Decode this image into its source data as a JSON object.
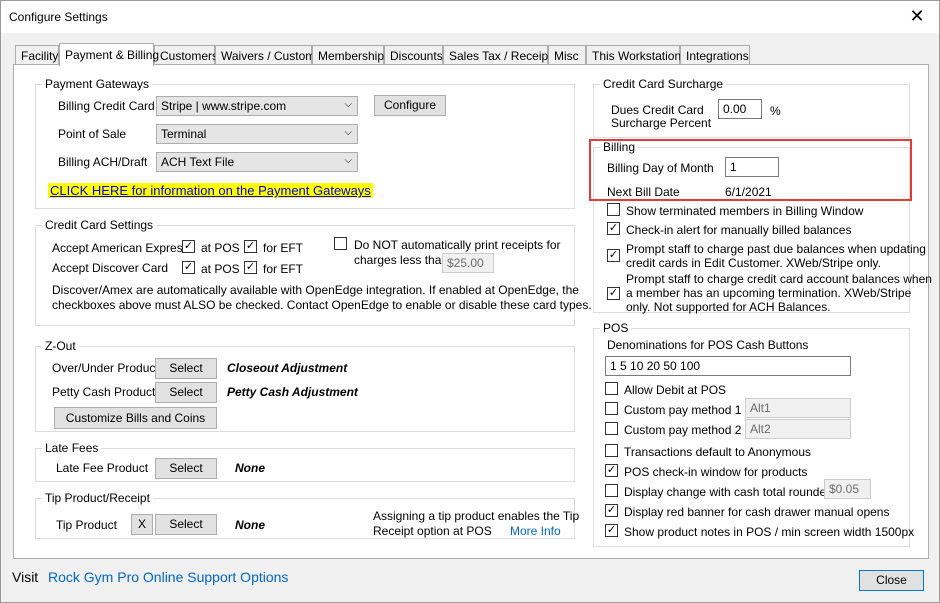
{
  "window": {
    "title": "Configure Settings",
    "close_glyph": "✕"
  },
  "tabs": [
    {
      "label": "Facility"
    },
    {
      "label": "Payment & Billing"
    },
    {
      "label": "Customers"
    },
    {
      "label": "Waivers / Custom"
    },
    {
      "label": "Memberships"
    },
    {
      "label": "Discounts"
    },
    {
      "label": "Sales Tax / Receipt"
    },
    {
      "label": "Misc"
    },
    {
      "label": "This Workstation"
    },
    {
      "label": "Integrations"
    }
  ],
  "payment_gateways": {
    "title": "Payment Gateways",
    "billing_cc_label": "Billing Credit Card",
    "billing_cc_value": "Stripe | www.stripe.com",
    "configure_label": "Configure",
    "pos_label": "Point of Sale",
    "pos_value": "Terminal",
    "ach_label": "Billing ACH/Draft",
    "ach_value": "ACH Text File",
    "info_link": "CLICK HERE for information on the Payment Gateways"
  },
  "cc_settings": {
    "title": "Credit Card Settings",
    "amex_label": "Accept American Express",
    "discover_label": "Accept Discover Card",
    "at_pos": "at POS",
    "for_eft": "for EFT",
    "no_print_line1": "Do NOT automatically print receipts for",
    "no_print_line2": "charges less than",
    "threshold": "$25.00",
    "note_line1": "Discover/Amex are automatically available with OpenEdge integration.  If enabled at OpenEdge, the",
    "note_line2": "checkboxes above must ALSO be checked.  Contact OpenEdge to enable or disable these card types."
  },
  "zout": {
    "title": "Z-Out",
    "over_under_label": "Over/Under Product",
    "over_under_value": "Closeout Adjustment",
    "petty_label": "Petty Cash Product",
    "petty_value": "Petty Cash Adjustment",
    "select_label": "Select",
    "customize_label": "Customize Bills and Coins"
  },
  "late_fees": {
    "title": "Late Fees",
    "product_label": "Late Fee Product",
    "select_label": "Select",
    "value": "None"
  },
  "tip": {
    "title": "Tip Product/Receipt",
    "product_label": "Tip Product",
    "clear_label": "X",
    "select_label": "Select",
    "value": "None",
    "note_line1": "Assigning a tip product enables the Tip",
    "note_line2": "Receipt option at POS",
    "more_info": "More Info"
  },
  "surcharge": {
    "title": "Credit Card Surcharge",
    "label_line1": "Dues Credit Card",
    "label_line2": "Surcharge Percent",
    "value": "0.00",
    "unit": "%"
  },
  "billing": {
    "title": "Billing",
    "day_label": "Billing Day of Month",
    "day_value": "1",
    "next_label": "Next Bill Date",
    "next_value": "6/1/2021",
    "opts": [
      {
        "label": "Show terminated members in Billing Window"
      },
      {
        "label": "Check-in alert for manually billed balances"
      },
      {
        "line1": "Prompt staff to charge past due balances when updating",
        "line2": "credit cards in Edit Customer.  XWeb/Stripe only."
      },
      {
        "line1": "Prompt staff to charge credit card account balances when",
        "line2": "a member has an upcoming termination.  XWeb/Stripe",
        "line3": "only.  Not supported for ACH Balances."
      }
    ]
  },
  "pos": {
    "title": "POS",
    "denom_label": "Denominations for POS Cash Buttons",
    "denom_value": "1 5 10 20 50 100",
    "allow_debit": "Allow Debit at POS",
    "custom1_label": "Custom pay method 1 >",
    "custom1_value": "Alt1",
    "custom2_label": "Custom pay method 2 >",
    "custom2_value": "Alt2",
    "anon": "Transactions default to Anonymous",
    "checkin_window": "POS check-in window for products",
    "display_change": "Display change with cash total rounded to",
    "rounding": "$0.05",
    "red_banner": "Display red banner for cash drawer manual opens",
    "product_notes": "Show product notes in POS / min screen width 1500px"
  },
  "footer": {
    "visit": "Visit",
    "support_link": "Rock Gym Pro Online Support Options",
    "close_label": "Close"
  },
  "check_glyph": "✓"
}
